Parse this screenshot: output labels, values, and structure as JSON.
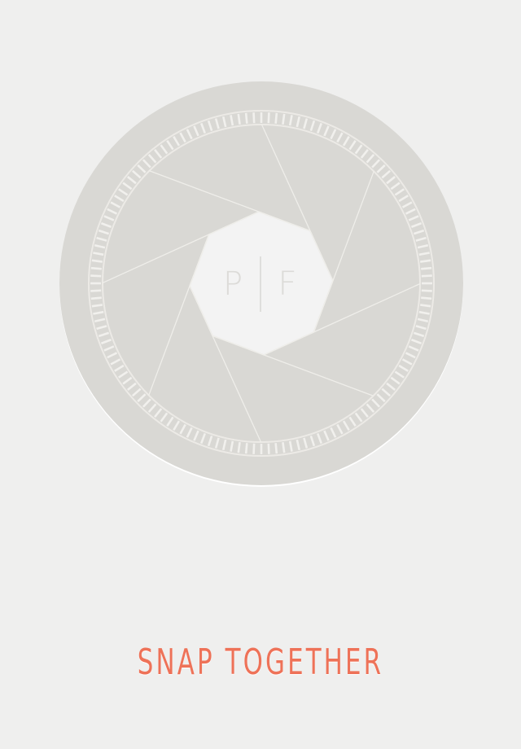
{
  "logo": {
    "left_letter": "P",
    "right_letter": "F"
  },
  "tagline": "SNAP TOGETHER",
  "colors": {
    "background": "#efefee",
    "lens": "#d9d8d4",
    "aperture": "#f3f3f3",
    "accent": "#ee7258"
  }
}
